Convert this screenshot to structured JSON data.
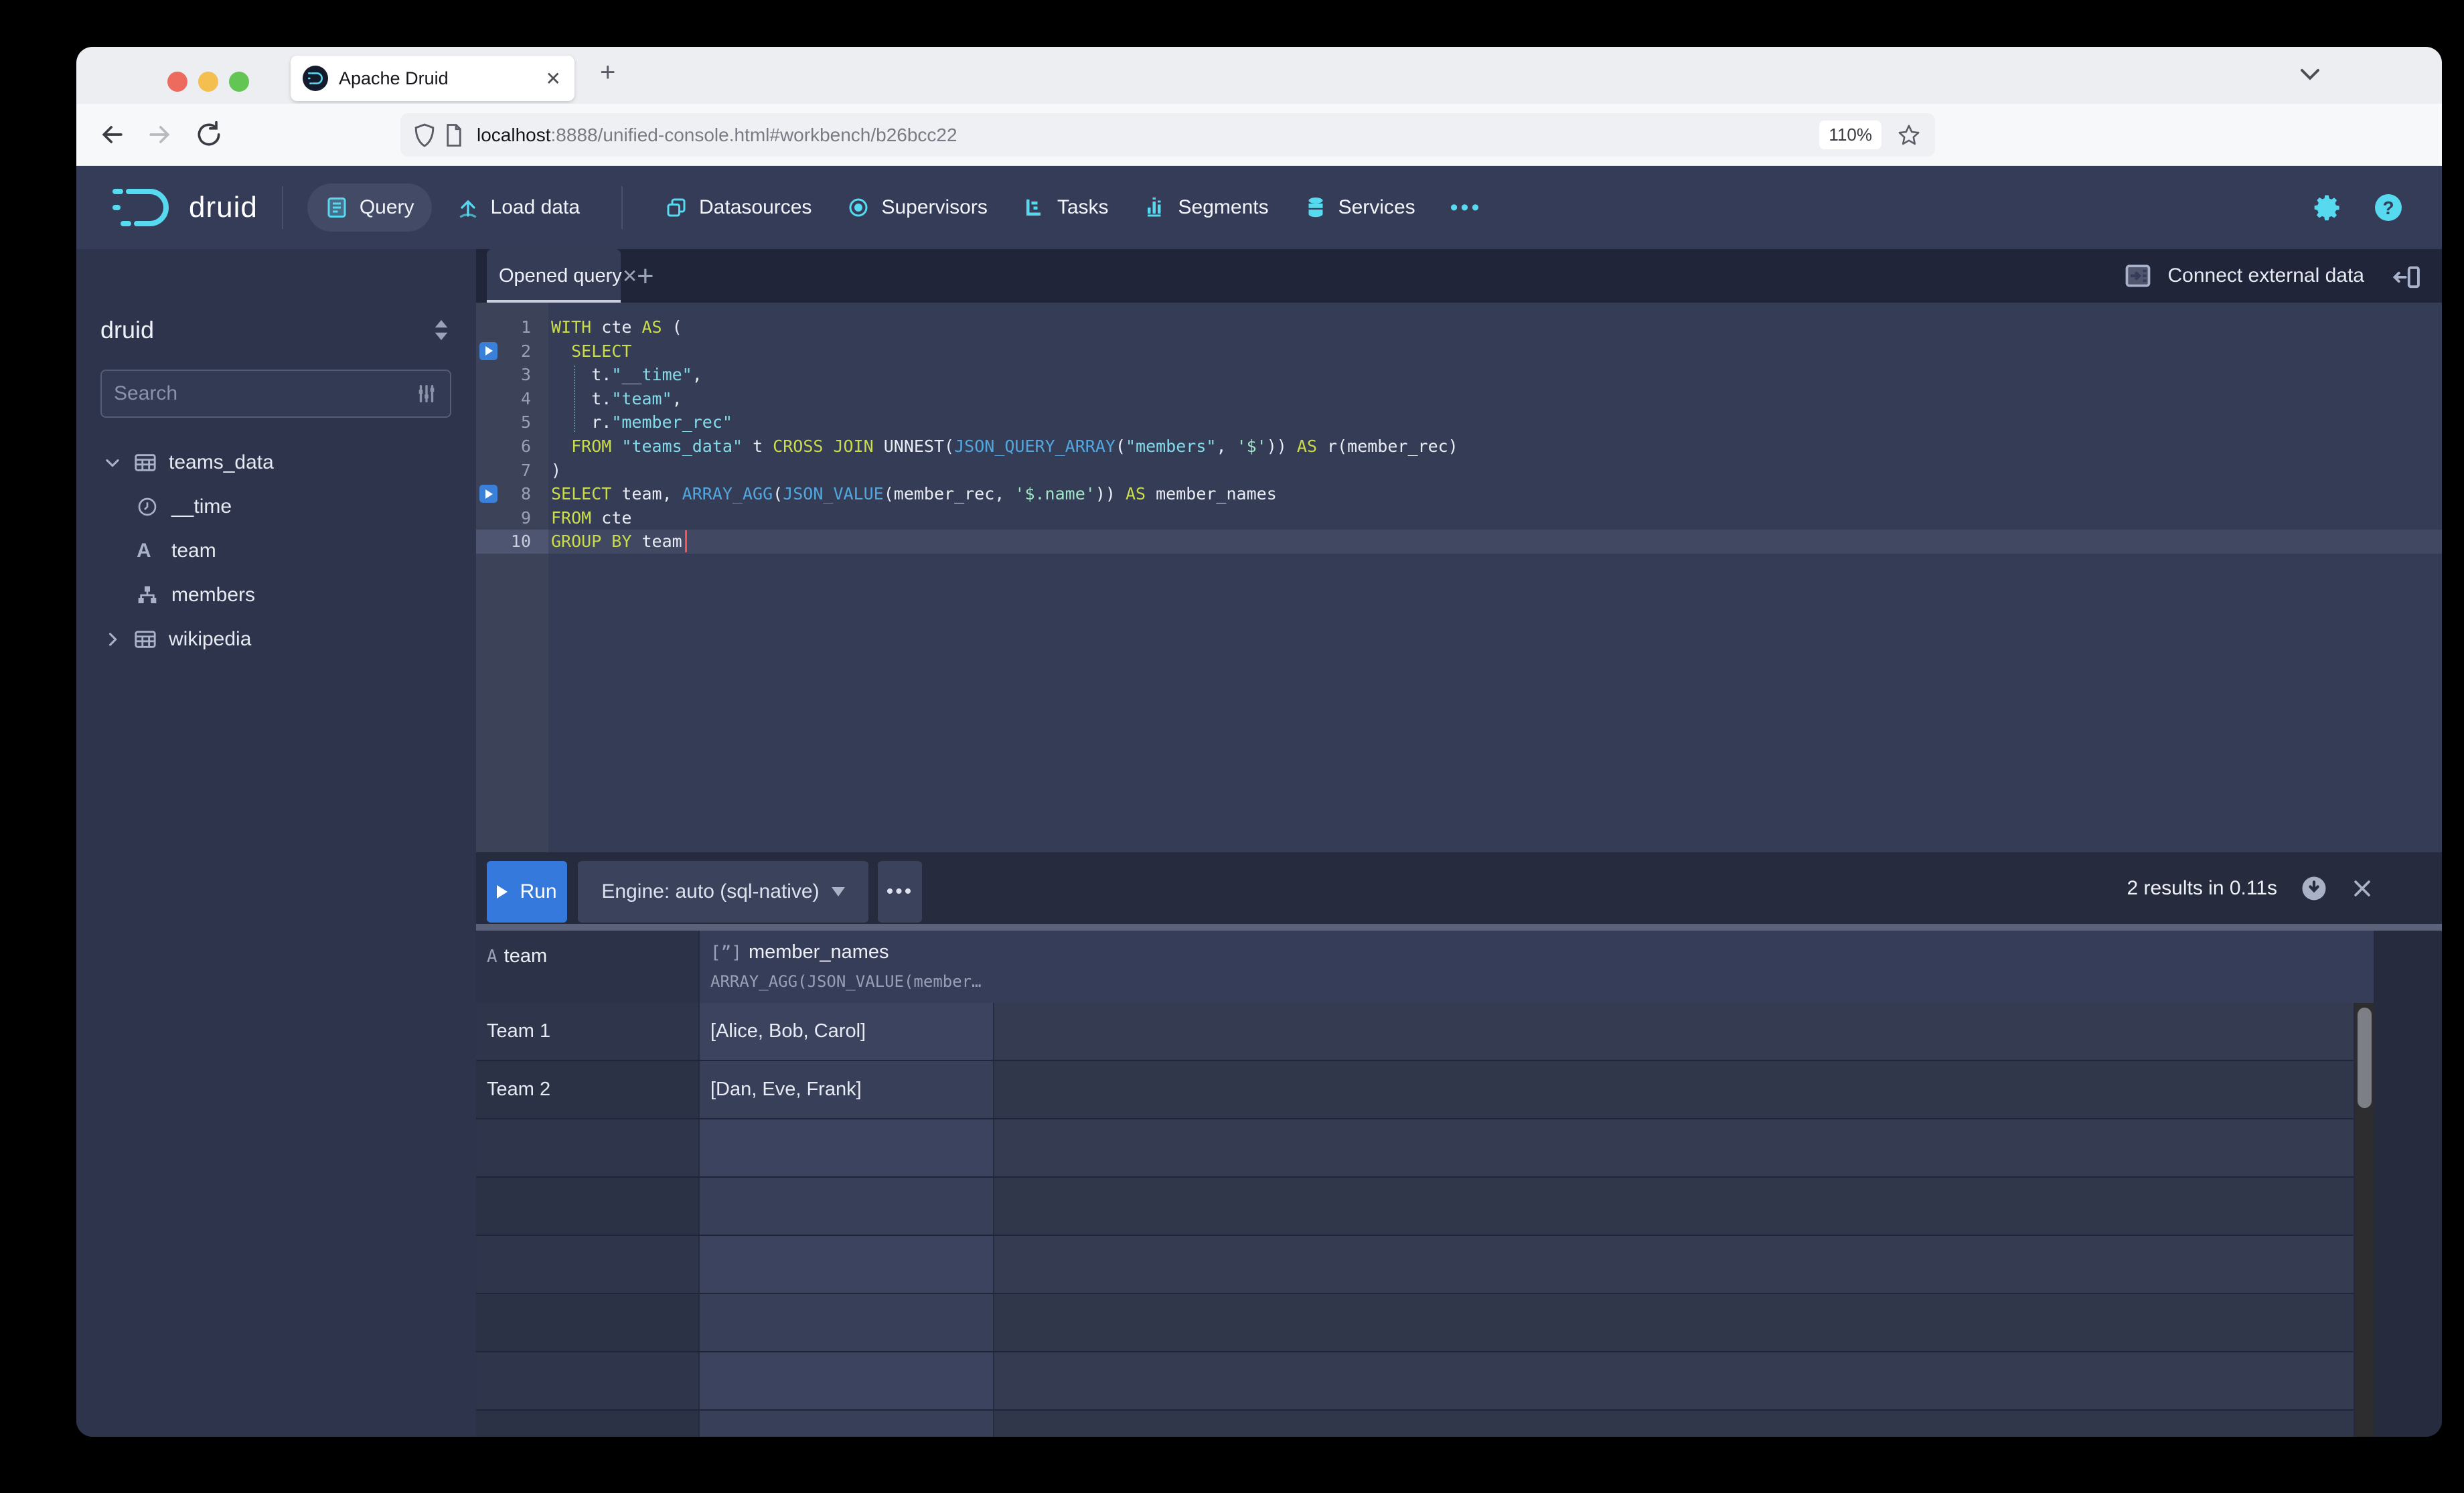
{
  "browser": {
    "tab_title": "Apache Druid",
    "new_tab_label": "+",
    "url_host": "localhost",
    "url_rest": ":8888/unified-console.html#workbench/b26bcc22",
    "zoom_level": "110%"
  },
  "navbar": {
    "brand": "druid",
    "items": [
      {
        "label": "Query",
        "active": true
      },
      {
        "label": "Load data",
        "active": false
      },
      {
        "label": "Datasources",
        "active": false
      },
      {
        "label": "Supervisors",
        "active": false
      },
      {
        "label": "Tasks",
        "active": false
      },
      {
        "label": "Segments",
        "active": false
      },
      {
        "label": "Services",
        "active": false
      }
    ],
    "more_label": "•••"
  },
  "sidebar": {
    "schema": "druid",
    "search_placeholder": "Search",
    "tree": [
      {
        "label": "teams_data",
        "icon": "table-icon",
        "expanded": true,
        "children": [
          {
            "label": "__time",
            "icon": "clock-icon"
          },
          {
            "label": "team",
            "icon": "string-icon"
          },
          {
            "label": "members",
            "icon": "nested-icon"
          }
        ]
      },
      {
        "label": "wikipedia",
        "icon": "table-icon",
        "expanded": false,
        "children": []
      }
    ]
  },
  "workbench": {
    "tab_label": "Opened query",
    "connect_label": "Connect external data"
  },
  "editor": {
    "lines": [
      {
        "n": 1,
        "tokens": [
          [
            "kw",
            "WITH"
          ],
          [
            "pl",
            " cte "
          ],
          [
            "kw",
            "AS"
          ],
          [
            "pl",
            " ("
          ]
        ]
      },
      {
        "n": 2,
        "play": true,
        "tokens": [
          [
            "pl",
            "  "
          ],
          [
            "kw",
            "SELECT"
          ]
        ]
      },
      {
        "n": 3,
        "tokens": [
          [
            "pl",
            "    t."
          ],
          [
            "id",
            "\"__time\""
          ],
          [
            "pl",
            ","
          ]
        ]
      },
      {
        "n": 4,
        "tokens": [
          [
            "pl",
            "    t."
          ],
          [
            "id",
            "\"team\""
          ],
          [
            "pl",
            ","
          ]
        ]
      },
      {
        "n": 5,
        "tokens": [
          [
            "pl",
            "    r."
          ],
          [
            "id",
            "\"member_rec\""
          ]
        ]
      },
      {
        "n": 6,
        "tokens": [
          [
            "pl",
            "  "
          ],
          [
            "kw",
            "FROM"
          ],
          [
            "pl",
            " "
          ],
          [
            "id",
            "\"teams_data\""
          ],
          [
            "pl",
            " t "
          ],
          [
            "kw",
            "CROSS JOIN"
          ],
          [
            "pl",
            " UNNEST("
          ],
          [
            "fn",
            "JSON_QUERY_ARRAY"
          ],
          [
            "pl",
            "("
          ],
          [
            "id",
            "\"members\""
          ],
          [
            "pl",
            ", "
          ],
          [
            "st",
            "'$'"
          ],
          [
            "pl",
            ")) "
          ],
          [
            "kw",
            "AS"
          ],
          [
            "pl",
            " r(member_rec)"
          ]
        ]
      },
      {
        "n": 7,
        "tokens": [
          [
            "pl",
            ")"
          ]
        ]
      },
      {
        "n": 8,
        "play": true,
        "tokens": [
          [
            "kw",
            "SELECT"
          ],
          [
            "pl",
            " team, "
          ],
          [
            "fn",
            "ARRAY_AGG"
          ],
          [
            "pl",
            "("
          ],
          [
            "fn",
            "JSON_VALUE"
          ],
          [
            "pl",
            "(member_rec, "
          ],
          [
            "st",
            "'$.name'"
          ],
          [
            "pl",
            ")) "
          ],
          [
            "kw",
            "AS"
          ],
          [
            "pl",
            " member_names"
          ]
        ]
      },
      {
        "n": 9,
        "tokens": [
          [
            "kw",
            "FROM"
          ],
          [
            "pl",
            " cte"
          ]
        ]
      },
      {
        "n": 10,
        "active": true,
        "cursor_after_chars": 13,
        "tokens": [
          [
            "kw",
            "GROUP BY"
          ],
          [
            "pl",
            " team"
          ]
        ]
      }
    ]
  },
  "runbar": {
    "run_label": "Run",
    "engine_label": "Engine: auto (sql-native)",
    "more_label": "•••",
    "status": "2 results in 0.11s"
  },
  "results": {
    "columns": [
      {
        "name": "team",
        "type_glyph": "A"
      },
      {
        "name": "member_names",
        "type_glyph": "[”]",
        "expr": "ARRAY_AGG(JSON_VALUE(member…"
      }
    ],
    "rows": [
      [
        "Team 1",
        "[Alice, Bob, Carol]"
      ],
      [
        "Team 2",
        "[Dan, Eve, Frank]"
      ]
    ],
    "empty_rows": 6
  },
  "colors": {
    "druid_cyan": "#57d9f0",
    "run_blue": "#3579dc",
    "keyword": "#cbdc4a",
    "function": "#52a7de",
    "quoted_identifier": "#83dbea",
    "string": "#9fe5c5",
    "traffic_red": "#ed6a5f",
    "traffic_yellow": "#f5bf4f",
    "traffic_green": "#62c554",
    "ublock_red": "#7c1f1f"
  }
}
